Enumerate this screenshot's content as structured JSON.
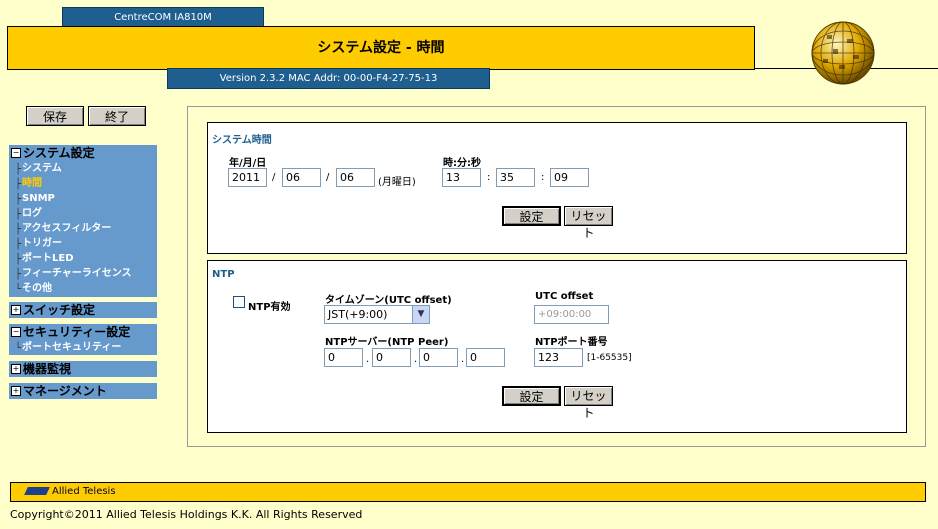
{
  "header": {
    "model": "CentreCOM IA810M",
    "title": "システム設定 - 時間",
    "version": "Version 2.3.2 MAC Addr: 00-00-F4-27-75-13"
  },
  "toolbar": {
    "save_label": "保存",
    "exit_label": "終了"
  },
  "sidebar": {
    "system": {
      "label": "システム設定",
      "items": [
        "システム",
        "時間",
        "SNMP",
        "ログ",
        "アクセスフィルター",
        "トリガー",
        "ポートLED",
        "フィーチャーライセンス",
        "その他"
      ],
      "active_index": 1
    },
    "switch": {
      "label": "スイッチ設定"
    },
    "security": {
      "label": "セキュリティー設定",
      "items": [
        "ポートセキュリティー"
      ]
    },
    "monitor": {
      "label": "機器監視"
    },
    "management": {
      "label": "マネージメント"
    }
  },
  "system_time": {
    "title": "システム時間",
    "date_label": "年/月/日",
    "year": "2011",
    "month": "06",
    "day": "06",
    "sep": "/",
    "weekday": "(月曜日)",
    "time_label": "時:分:秒",
    "hour": "13",
    "minute": "35",
    "second": "09",
    "time_sep": ":",
    "set_label": "設定",
    "reset_label": "リセット"
  },
  "ntp": {
    "title": "NTP",
    "enable_label": "NTP有効",
    "enabled": false,
    "timezone_label": "タイムゾーン(UTC offset)",
    "timezone_value": "JST(+9:00)",
    "utc_offset_label": "UTC offset",
    "utc_offset_value": "+09:00:00",
    "server_label": "NTPサーバー(NTP Peer)",
    "server_ip": [
      "0",
      "0",
      "0",
      "0"
    ],
    "dot": ".",
    "port_label": "NTPポート番号",
    "port_value": "123",
    "port_range": "[1-65535]",
    "set_label": "設定",
    "reset_label": "リセット"
  },
  "footer": {
    "logo": "Allied Telesis",
    "copyright": "Copyright©2011 Allied Telesis Holdings K.K. All Rights Reserved"
  },
  "colors": {
    "accent": "#ffcc00",
    "nav": "#6699cc",
    "header_blue": "#1f5f8f",
    "background": "#ffffcc"
  }
}
